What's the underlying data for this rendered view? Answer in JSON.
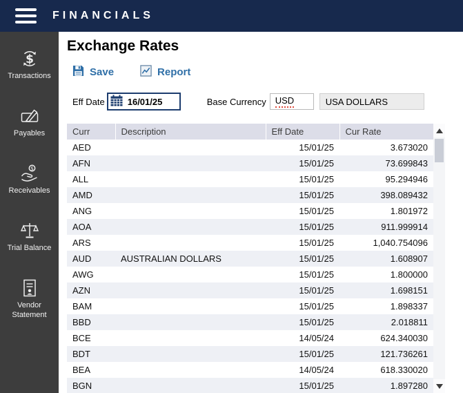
{
  "app": {
    "title": "FINANCIALS"
  },
  "sidebar": {
    "items": [
      {
        "label": "Transactions",
        "icon": "transactions-dollar-icon"
      },
      {
        "label": "Payables",
        "icon": "payables-edit-icon"
      },
      {
        "label": "Receivables",
        "icon": "receivables-hand-icon"
      },
      {
        "label": "Trial Balance",
        "icon": "trial-balance-scale-icon"
      },
      {
        "label": "Vendor Statement",
        "icon": "vendor-statement-document-icon"
      }
    ]
  },
  "main": {
    "title": "Exchange Rates",
    "toolbar": {
      "save_label": "Save",
      "report_label": "Report"
    },
    "form": {
      "eff_date_label": "Eff Date",
      "eff_date_value": "16/01/25",
      "base_currency_label": "Base Currency",
      "base_currency_code": "USD",
      "base_currency_name": "USA DOLLARS"
    },
    "table": {
      "headers": [
        "Curr",
        "Description",
        "Eff Date",
        "Cur Rate"
      ],
      "rows": [
        [
          "AED",
          "",
          "15/01/25",
          "3.673020"
        ],
        [
          "AFN",
          "",
          "15/01/25",
          "73.699843"
        ],
        [
          "ALL",
          "",
          "15/01/25",
          "95.294946"
        ],
        [
          "AMD",
          "",
          "15/01/25",
          "398.089432"
        ],
        [
          "ANG",
          "",
          "15/01/25",
          "1.801972"
        ],
        [
          "AOA",
          "",
          "15/01/25",
          "911.999914"
        ],
        [
          "ARS",
          "",
          "15/01/25",
          "1,040.754096"
        ],
        [
          "AUD",
          "AUSTRALIAN DOLLARS",
          "15/01/25",
          "1.608907"
        ],
        [
          "AWG",
          "",
          "15/01/25",
          "1.800000"
        ],
        [
          "AZN",
          "",
          "15/01/25",
          "1.698151"
        ],
        [
          "BAM",
          "",
          "15/01/25",
          "1.898337"
        ],
        [
          "BBD",
          "",
          "15/01/25",
          "2.018811"
        ],
        [
          "BCE",
          "",
          "14/05/24",
          "624.340030"
        ],
        [
          "BDT",
          "",
          "15/01/25",
          "121.736261"
        ],
        [
          "BEA",
          "",
          "14/05/24",
          "618.330020"
        ],
        [
          "BGN",
          "",
          "15/01/25",
          "1.897280"
        ]
      ]
    }
  },
  "colors": {
    "topbar": "#17294d",
    "sidebar": "#3d3d3d",
    "accent_blue": "#2f6fa7",
    "table_header_bg": "#dcdde8",
    "row_alt_bg": "#eef0f5",
    "focus_border": "#1c3c6e",
    "spellcheck_red": "#e04b3c"
  }
}
